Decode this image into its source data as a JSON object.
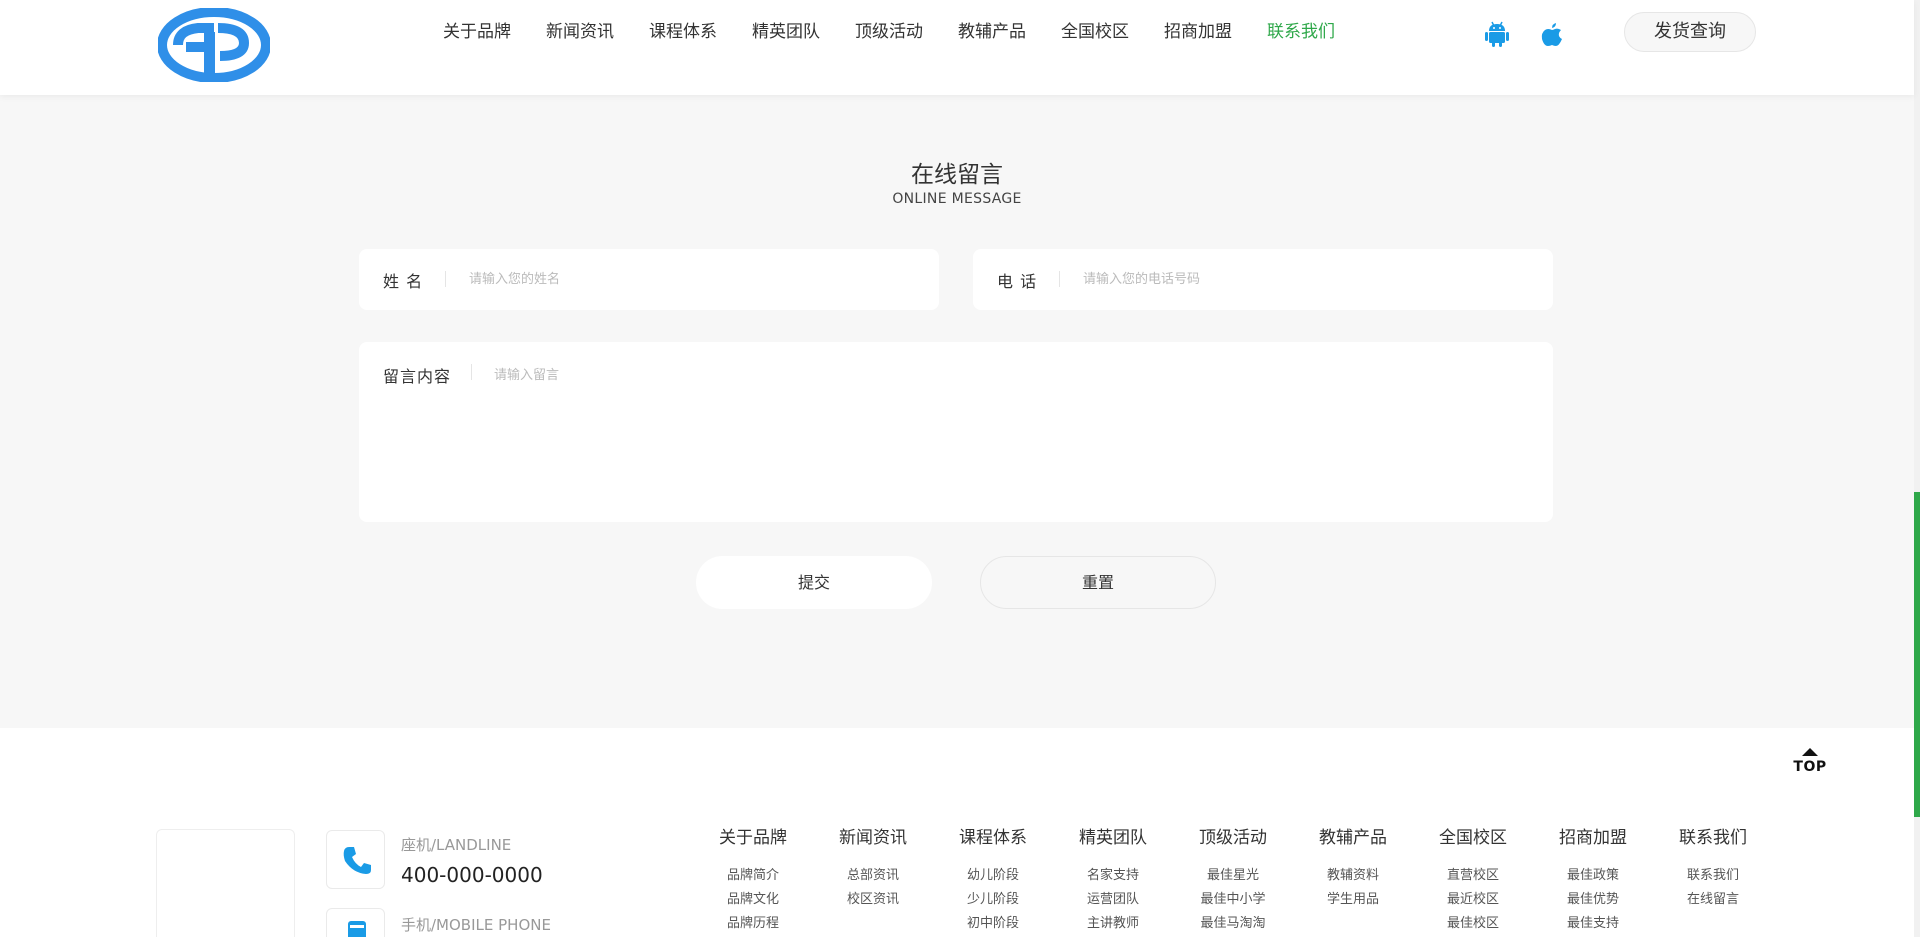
{
  "header": {
    "nav": [
      "关于品牌",
      "新闻资讯",
      "课程体系",
      "精英团队",
      "顶级活动",
      "教辅产品",
      "全国校区",
      "招商加盟",
      "联系我们"
    ],
    "active_nav": "联系我们",
    "ship_query_label": "发货查询",
    "android_icon": "android-icon",
    "apple_icon": "apple-icon",
    "brand_color": "#2f8fe8",
    "accent_color": "#2fa84a"
  },
  "message": {
    "title": "在线留言",
    "subtitle": "ONLINE MESSAGE",
    "name_label": "姓 名",
    "name_placeholder": "请输入您的姓名",
    "phone_label": "电 话",
    "phone_placeholder": "请输入您的电话号码",
    "content_label": "留言内容",
    "content_placeholder": "请输入留言",
    "submit_label": "提交",
    "reset_label": "重置"
  },
  "footer": {
    "top_label": "TOP",
    "landline_key": "座机/LANDLINE",
    "landline_value": "400-000-0000",
    "mobile_key": "手机/MOBILE PHONE",
    "columns": [
      {
        "title": "关于品牌",
        "links": [
          "品牌简介",
          "品牌文化",
          "品牌历程"
        ]
      },
      {
        "title": "新闻资讯",
        "links": [
          "总部资讯",
          "校区资讯"
        ]
      },
      {
        "title": "课程体系",
        "links": [
          "幼儿阶段",
          "少儿阶段",
          "初中阶段"
        ]
      },
      {
        "title": "精英团队",
        "links": [
          "名家支持",
          "运营团队",
          "主讲教师"
        ]
      },
      {
        "title": "顶级活动",
        "links": [
          "最佳星光",
          "最佳中小学",
          "最佳马淘淘"
        ]
      },
      {
        "title": "教辅产品",
        "links": [
          "教辅资料",
          "学生用品"
        ]
      },
      {
        "title": "全国校区",
        "links": [
          "直营校区",
          "最近校区",
          "最佳校区"
        ]
      },
      {
        "title": "招商加盟",
        "links": [
          "最佳政策",
          "最佳优势",
          "最佳支持"
        ]
      },
      {
        "title": "联系我们",
        "links": [
          "联系我们",
          "在线留言"
        ]
      }
    ]
  }
}
